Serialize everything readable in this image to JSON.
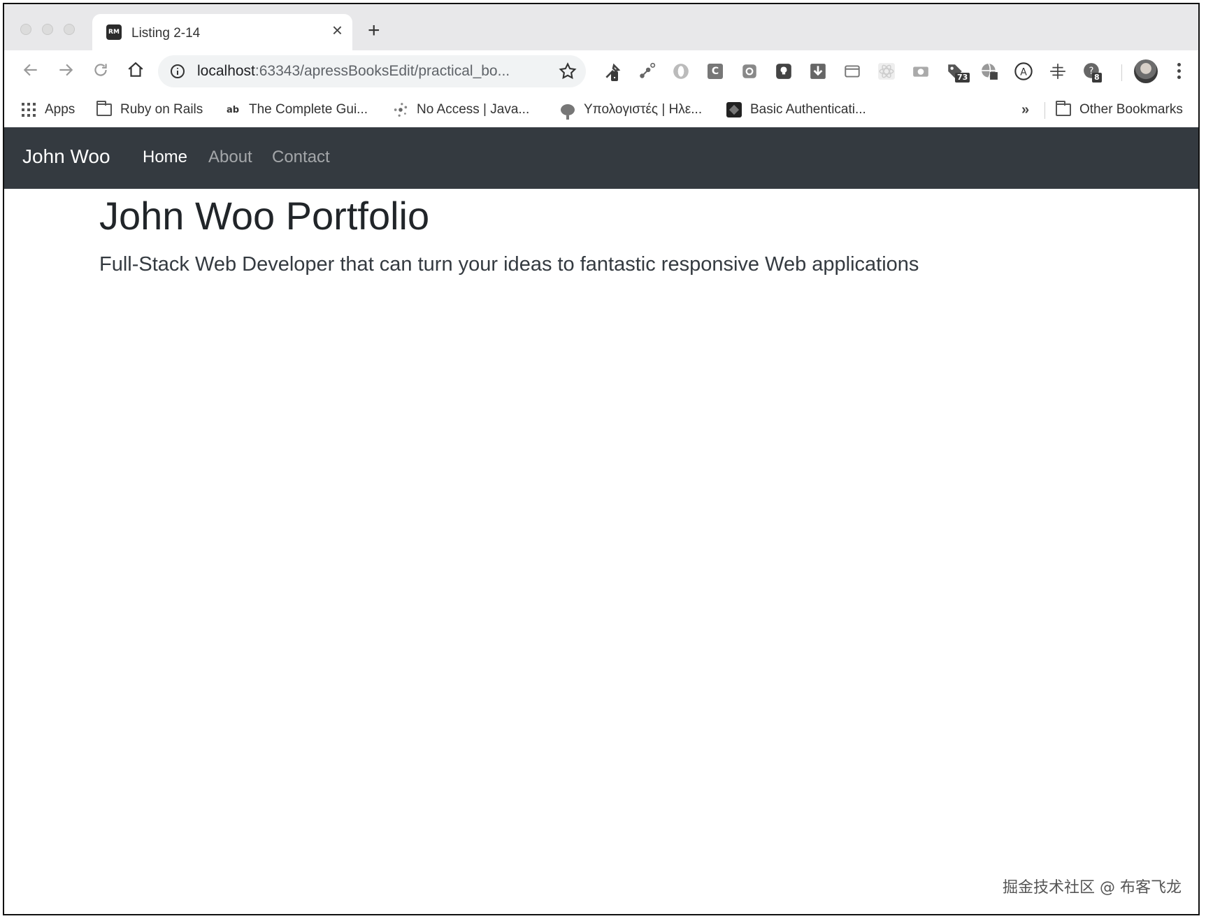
{
  "browser": {
    "tab": {
      "title": "Listing 2-14",
      "favicon_text": "RM"
    },
    "url": {
      "host": "localhost",
      "rest": ":63343/apressBooksEdit/practical_bo..."
    },
    "extensions": [
      {
        "name": "eyedropper-ext-icon"
      },
      {
        "name": "network-ext-icon"
      },
      {
        "name": "opera-ext-icon"
      },
      {
        "name": "c-ext-icon",
        "text": "C"
      },
      {
        "name": "gear-ext-icon"
      },
      {
        "name": "lightbulb-ext-icon"
      },
      {
        "name": "download-ext-icon"
      },
      {
        "name": "window-ext-icon"
      },
      {
        "name": "react-ext-icon"
      },
      {
        "name": "camera-ext-icon"
      },
      {
        "name": "tag-ext-icon",
        "badge": "73"
      },
      {
        "name": "globe-ext-icon"
      },
      {
        "name": "a-circle-ext-icon",
        "text": "A"
      },
      {
        "name": "move-ext-icon"
      },
      {
        "name": "q-ext-icon",
        "badge": "8"
      }
    ]
  },
  "bookmarks": {
    "apps": "Apps",
    "items": [
      {
        "label": "Ruby on Rails"
      },
      {
        "label": "The Complete Gui..."
      },
      {
        "label": "No Access | Java..."
      },
      {
        "label": "Υπολογιστές | Ηλε..."
      },
      {
        "label": "Basic Authenticati..."
      }
    ],
    "overflow": "»",
    "other": "Other Bookmarks"
  },
  "site": {
    "brand": "John Woo",
    "nav": [
      {
        "label": "Home",
        "active": true
      },
      {
        "label": "About",
        "active": false
      },
      {
        "label": "Contact",
        "active": false
      }
    ],
    "hero": {
      "title": "John Woo Portfolio",
      "lead": "Full-Stack Web Developer that can turn your ideas to fantastic responsive Web applications"
    }
  },
  "watermark": "掘金技术社区 @ 布客飞龙"
}
